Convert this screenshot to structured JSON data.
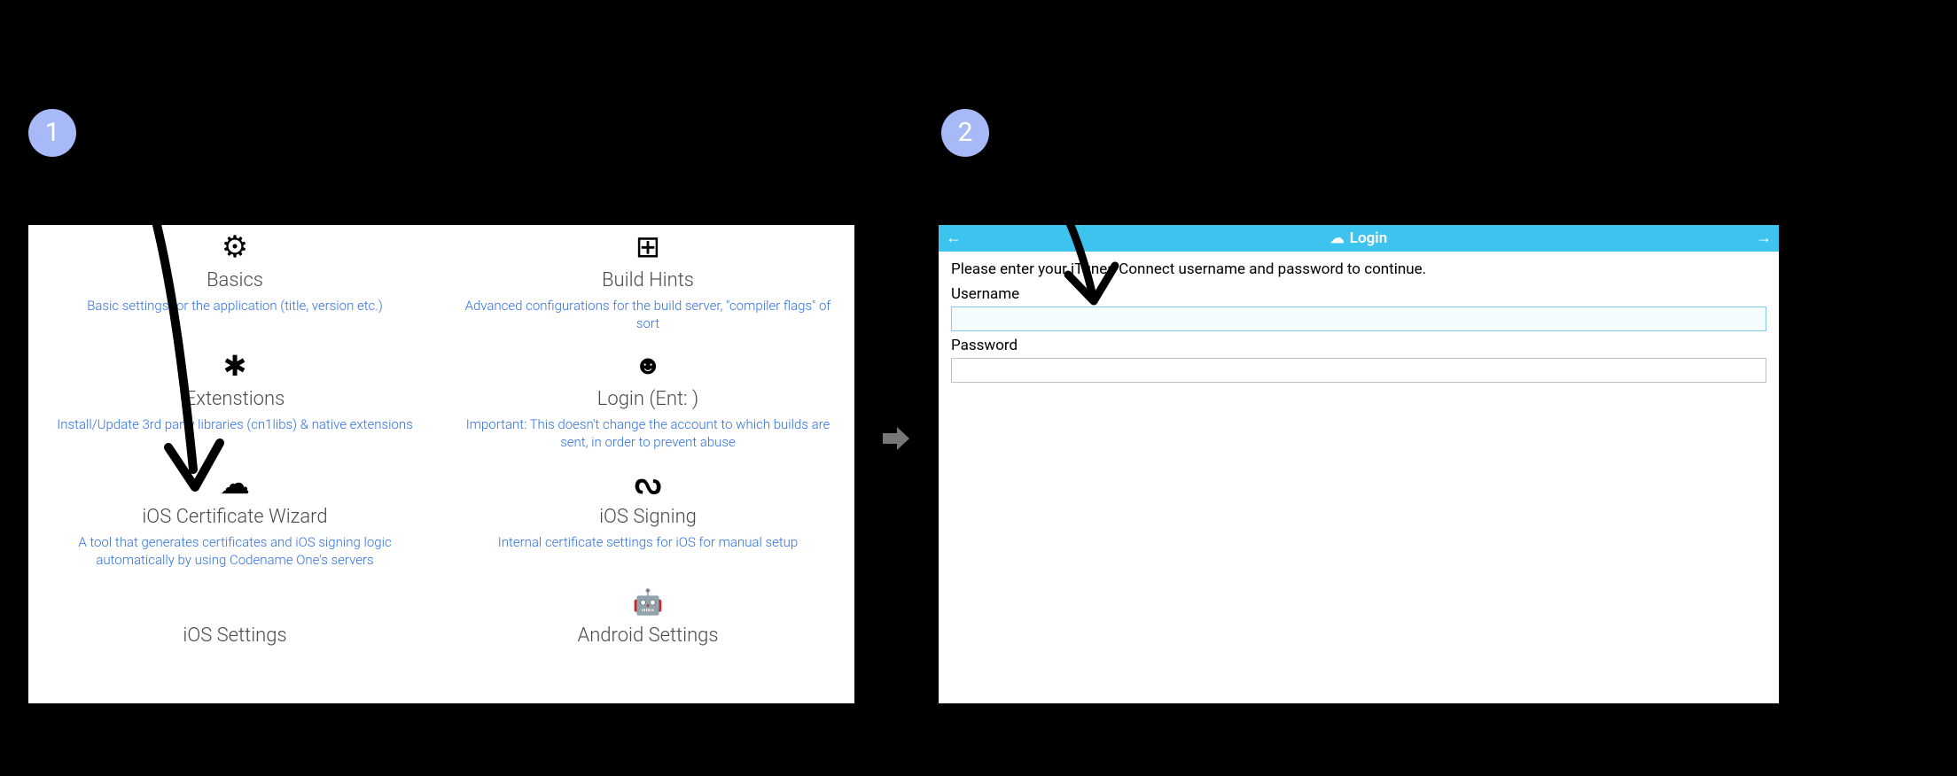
{
  "step_labels": {
    "one": "1",
    "two": "2"
  },
  "panel1": {
    "tiles": [
      {
        "icon": "⚙",
        "title": "Basics",
        "desc": "Basic settings for the application (title, version etc.)"
      },
      {
        "icon": "⊞",
        "title": "Build Hints",
        "desc": "Advanced configurations for the build server, \"compiler flags\" of sort"
      },
      {
        "icon": "✱",
        "title": "Extenstions",
        "desc": "Install/Update 3rd party libraries (cn1libs) & native extensions"
      },
      {
        "icon": "☻",
        "title": "Login (Ent:                                    )",
        "desc": "Important: This doesn't change the account to which builds are sent, in order to prevent abuse"
      },
      {
        "icon": "☁",
        "title": "iOS Certificate Wizard",
        "desc": "A tool that generates certificates and iOS signing logic automatically by using Codename One's servers"
      },
      {
        "icon": "ᔓ",
        "title": "iOS Signing",
        "desc": "Internal certificate settings for iOS for manual setup"
      },
      {
        "icon": "",
        "title": "iOS Settings",
        "desc": ""
      },
      {
        "icon": "🤖",
        "title": "Android Settings",
        "desc": ""
      }
    ]
  },
  "panel2": {
    "header": {
      "back": "←",
      "forward": "→",
      "cloud": "☁",
      "title": "Login"
    },
    "message": "Please enter your iTunes Connect username and password to continue.",
    "username_label": "Username",
    "password_label": "Password",
    "username_value": "",
    "password_value": ""
  }
}
